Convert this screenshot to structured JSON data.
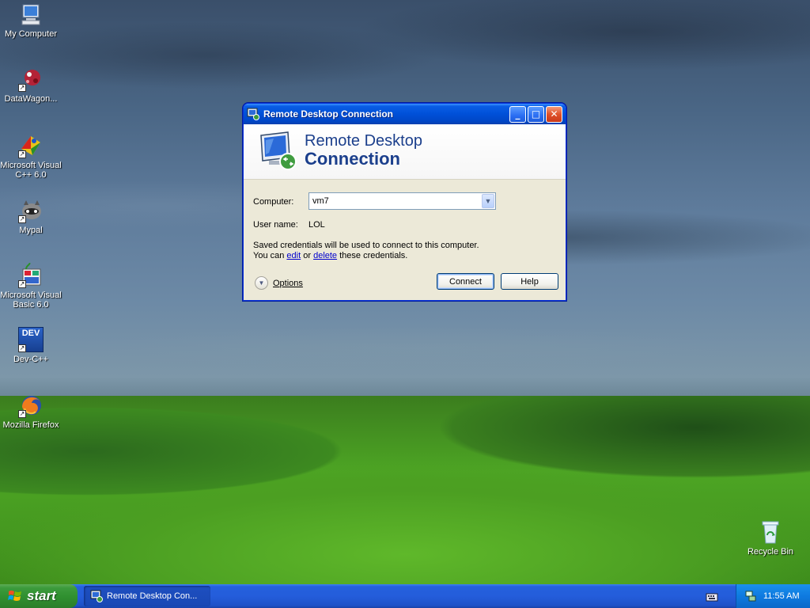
{
  "desktop": {
    "icons": [
      {
        "label": "My Computer"
      },
      {
        "label": "DataWagon..."
      },
      {
        "label_line1": "Microsoft Visual",
        "label_line2": "C++ 6.0"
      },
      {
        "label": "Mypal"
      },
      {
        "label_line1": "Microsoft Visual",
        "label_line2": "Basic 6.0"
      },
      {
        "label": "Dev-C++",
        "badge": "DEV"
      },
      {
        "label": "Mozilla Firefox"
      },
      {
        "label": "Recycle Bin"
      }
    ]
  },
  "window": {
    "title": "Remote Desktop Connection",
    "buttons": {
      "minimize": "_",
      "maximize": "□",
      "close": "✕"
    },
    "banner": {
      "line1": "Remote Desktop",
      "line2": "Connection"
    },
    "computer_label": "Computer:",
    "computer_value": "vm7",
    "username_label": "User name:",
    "username_value": "LOL",
    "saved_line1": "Saved credentials will be used to connect to this computer.",
    "saved_prefix": "You can ",
    "edit_link": "edit",
    "saved_or": " or ",
    "delete_link": "delete",
    "saved_suffix": " these credentials.",
    "options_label": "Options",
    "connect_label": "Connect",
    "help_label": "Help"
  },
  "taskbar": {
    "start_label": "start",
    "task_label": "Remote Desktop Con...",
    "clock": "11:55 AM"
  },
  "colors": {
    "title_blue": "#0050d8",
    "banner_text": "#1b3f8c",
    "start_green": "#3c9b3c",
    "taskbar_blue": "#245ddb",
    "tray_blue": "#0e7ae0"
  }
}
